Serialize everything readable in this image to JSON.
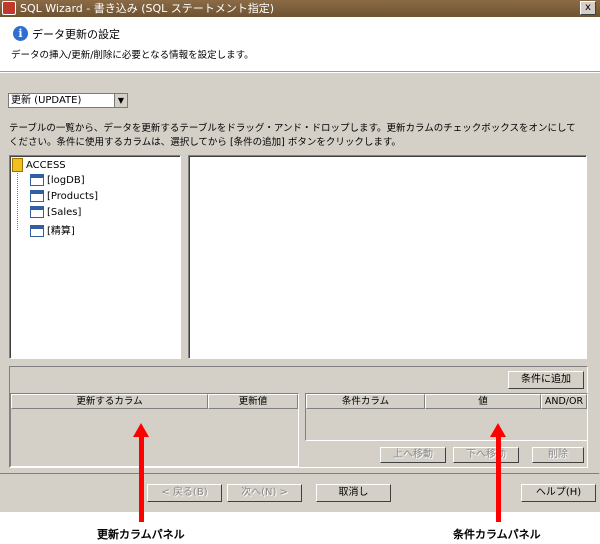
{
  "window": {
    "title": "SQL Wizard - 書き込み (SQL ステートメント指定)",
    "close_label": "x"
  },
  "header": {
    "title": "データ更新の設定",
    "description": "データの挿入/更新/削除に必要となる情報を設定します。"
  },
  "operation": {
    "selected": "更新 (UPDATE)"
  },
  "instructions": {
    "line1": "テーブルの一覧から、データを更新するテーブルをドラッグ・アンド・ドロップします。更新カラムのチェックボックスをオンにして",
    "line2": "ください。条件に使用するカラムは、選択してから [条件の追加] ボタンをクリックします。"
  },
  "tree": {
    "root": "ACCESS",
    "items": [
      "[logDB]",
      "[Products]",
      "[Sales]",
      "[精算]"
    ]
  },
  "buttons": {
    "add_condition": "条件に追加",
    "move_up": "上へ移動",
    "move_down": "下へ移動",
    "delete": "削除",
    "back": "< 戻る(B)",
    "next": "次へ(N) >",
    "cancel": "取消し",
    "help": "ヘルプ(H)"
  },
  "update_panel": {
    "col_column": "更新するカラム",
    "col_value": "更新値"
  },
  "condition_panel": {
    "col_column": "条件カラム",
    "col_value": "値",
    "col_andor": "AND/OR"
  },
  "annotations": {
    "left_caption": "更新カラムパネル",
    "right_caption": "条件カラムパネル"
  },
  "colors": {
    "annotation_arrow": "#ff0000",
    "dialog_bg": "#d4d0c8"
  }
}
